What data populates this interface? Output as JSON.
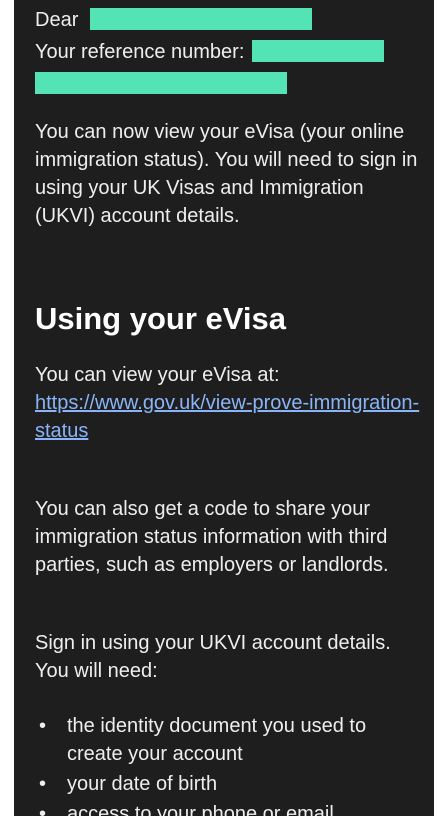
{
  "greeting": {
    "dear_label": "Dear",
    "reference_label": "Your reference number:"
  },
  "intro": "You can now view your eVisa (your online immigration status). You will need to sign in using your UK Visas and Immigration (UKVI) account details.",
  "section": {
    "heading": "Using your eVisa",
    "view_text": "You can view your eVisa at:",
    "link_text": "https://www.gov.uk/view-prove-immigration-status",
    "share_text": "You can also get a code to share your immigration status information with third parties, such as employers or landlords.",
    "signin_text": "Sign in using your UKVI account details. You will need:",
    "requirements": [
      "the identity document you used to create your account",
      "your date of birth",
      "access to your phone or email"
    ]
  },
  "colors": {
    "background": "#1e1e1e",
    "text": "#eeeeee",
    "link": "#8ab4f8",
    "redaction": "#54e3b4"
  }
}
